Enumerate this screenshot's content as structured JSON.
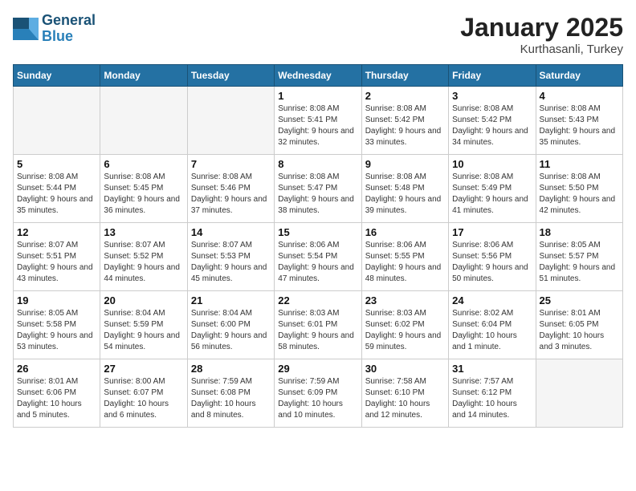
{
  "logo": {
    "text1": "General",
    "text2": "Blue"
  },
  "title": "January 2025",
  "subtitle": "Kurthasanli, Turkey",
  "days_of_week": [
    "Sunday",
    "Monday",
    "Tuesday",
    "Wednesday",
    "Thursday",
    "Friday",
    "Saturday"
  ],
  "weeks": [
    [
      {
        "day": "",
        "info": ""
      },
      {
        "day": "",
        "info": ""
      },
      {
        "day": "",
        "info": ""
      },
      {
        "day": "1",
        "info": "Sunrise: 8:08 AM\nSunset: 5:41 PM\nDaylight: 9 hours and 32 minutes."
      },
      {
        "day": "2",
        "info": "Sunrise: 8:08 AM\nSunset: 5:42 PM\nDaylight: 9 hours and 33 minutes."
      },
      {
        "day": "3",
        "info": "Sunrise: 8:08 AM\nSunset: 5:42 PM\nDaylight: 9 hours and 34 minutes."
      },
      {
        "day": "4",
        "info": "Sunrise: 8:08 AM\nSunset: 5:43 PM\nDaylight: 9 hours and 35 minutes."
      }
    ],
    [
      {
        "day": "5",
        "info": "Sunrise: 8:08 AM\nSunset: 5:44 PM\nDaylight: 9 hours and 35 minutes."
      },
      {
        "day": "6",
        "info": "Sunrise: 8:08 AM\nSunset: 5:45 PM\nDaylight: 9 hours and 36 minutes."
      },
      {
        "day": "7",
        "info": "Sunrise: 8:08 AM\nSunset: 5:46 PM\nDaylight: 9 hours and 37 minutes."
      },
      {
        "day": "8",
        "info": "Sunrise: 8:08 AM\nSunset: 5:47 PM\nDaylight: 9 hours and 38 minutes."
      },
      {
        "day": "9",
        "info": "Sunrise: 8:08 AM\nSunset: 5:48 PM\nDaylight: 9 hours and 39 minutes."
      },
      {
        "day": "10",
        "info": "Sunrise: 8:08 AM\nSunset: 5:49 PM\nDaylight: 9 hours and 41 minutes."
      },
      {
        "day": "11",
        "info": "Sunrise: 8:08 AM\nSunset: 5:50 PM\nDaylight: 9 hours and 42 minutes."
      }
    ],
    [
      {
        "day": "12",
        "info": "Sunrise: 8:07 AM\nSunset: 5:51 PM\nDaylight: 9 hours and 43 minutes."
      },
      {
        "day": "13",
        "info": "Sunrise: 8:07 AM\nSunset: 5:52 PM\nDaylight: 9 hours and 44 minutes."
      },
      {
        "day": "14",
        "info": "Sunrise: 8:07 AM\nSunset: 5:53 PM\nDaylight: 9 hours and 45 minutes."
      },
      {
        "day": "15",
        "info": "Sunrise: 8:06 AM\nSunset: 5:54 PM\nDaylight: 9 hours and 47 minutes."
      },
      {
        "day": "16",
        "info": "Sunrise: 8:06 AM\nSunset: 5:55 PM\nDaylight: 9 hours and 48 minutes."
      },
      {
        "day": "17",
        "info": "Sunrise: 8:06 AM\nSunset: 5:56 PM\nDaylight: 9 hours and 50 minutes."
      },
      {
        "day": "18",
        "info": "Sunrise: 8:05 AM\nSunset: 5:57 PM\nDaylight: 9 hours and 51 minutes."
      }
    ],
    [
      {
        "day": "19",
        "info": "Sunrise: 8:05 AM\nSunset: 5:58 PM\nDaylight: 9 hours and 53 minutes."
      },
      {
        "day": "20",
        "info": "Sunrise: 8:04 AM\nSunset: 5:59 PM\nDaylight: 9 hours and 54 minutes."
      },
      {
        "day": "21",
        "info": "Sunrise: 8:04 AM\nSunset: 6:00 PM\nDaylight: 9 hours and 56 minutes."
      },
      {
        "day": "22",
        "info": "Sunrise: 8:03 AM\nSunset: 6:01 PM\nDaylight: 9 hours and 58 minutes."
      },
      {
        "day": "23",
        "info": "Sunrise: 8:03 AM\nSunset: 6:02 PM\nDaylight: 9 hours and 59 minutes."
      },
      {
        "day": "24",
        "info": "Sunrise: 8:02 AM\nSunset: 6:04 PM\nDaylight: 10 hours and 1 minute."
      },
      {
        "day": "25",
        "info": "Sunrise: 8:01 AM\nSunset: 6:05 PM\nDaylight: 10 hours and 3 minutes."
      }
    ],
    [
      {
        "day": "26",
        "info": "Sunrise: 8:01 AM\nSunset: 6:06 PM\nDaylight: 10 hours and 5 minutes."
      },
      {
        "day": "27",
        "info": "Sunrise: 8:00 AM\nSunset: 6:07 PM\nDaylight: 10 hours and 6 minutes."
      },
      {
        "day": "28",
        "info": "Sunrise: 7:59 AM\nSunset: 6:08 PM\nDaylight: 10 hours and 8 minutes."
      },
      {
        "day": "29",
        "info": "Sunrise: 7:59 AM\nSunset: 6:09 PM\nDaylight: 10 hours and 10 minutes."
      },
      {
        "day": "30",
        "info": "Sunrise: 7:58 AM\nSunset: 6:10 PM\nDaylight: 10 hours and 12 minutes."
      },
      {
        "day": "31",
        "info": "Sunrise: 7:57 AM\nSunset: 6:12 PM\nDaylight: 10 hours and 14 minutes."
      },
      {
        "day": "",
        "info": ""
      }
    ]
  ]
}
